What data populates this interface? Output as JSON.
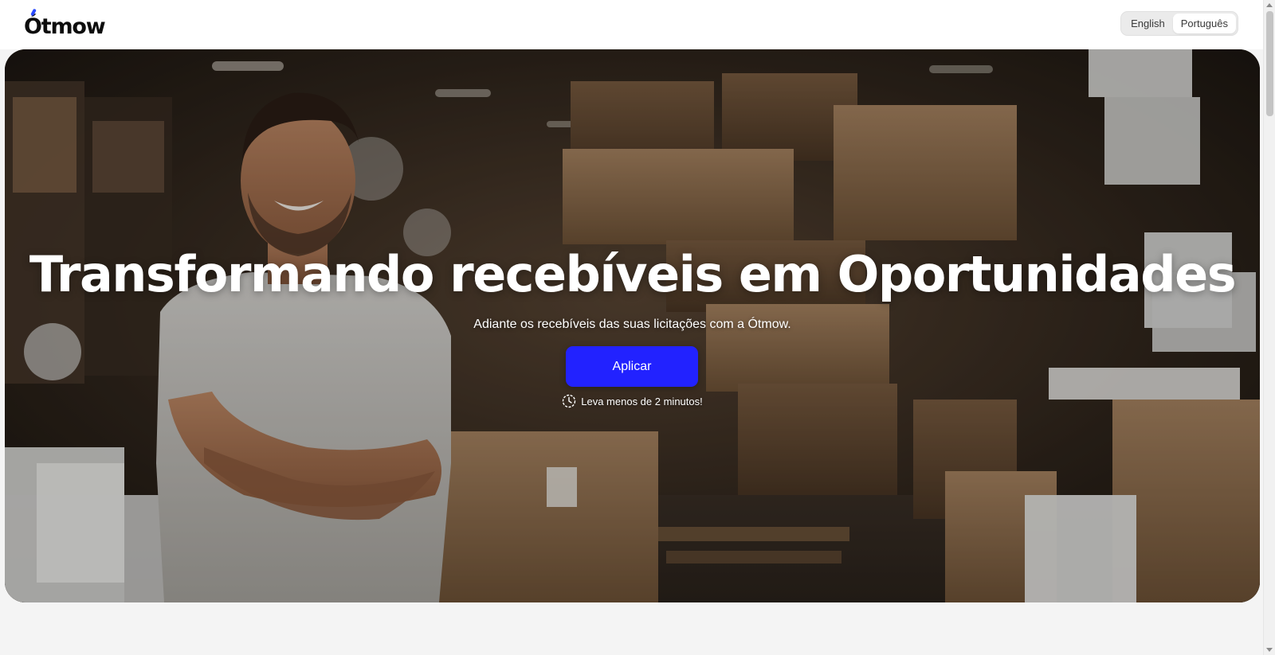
{
  "header": {
    "logo_text": "Ótmow",
    "languages": [
      {
        "label": "English",
        "active": false
      },
      {
        "label": "Português",
        "active": true
      }
    ]
  },
  "hero": {
    "title": "Transformando recebíveis em Oportunidades",
    "subtitle": "Adiante os recebíveis das suas licitações com a Ótmow.",
    "cta_label": "Aplicar",
    "hint_text": "Leva menos de 2 minutos!",
    "hint_icon": "clock-icon",
    "background": "warehouse-photo-smiling-man"
  },
  "colors": {
    "accent": "#2222ff",
    "logo_accent": "#2a4bff",
    "page_background": "#f4f4f4"
  }
}
